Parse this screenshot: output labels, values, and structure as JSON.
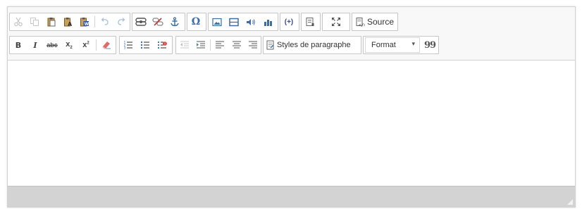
{
  "toolbar": {
    "source_label": "Source",
    "styles_label": "Styles de paragraphe",
    "format_label": "Format",
    "format_arrow": "▾",
    "bold_label": "B",
    "italic_label": "I",
    "strike_label": "abc",
    "subscript_label": "x",
    "subscript_mark": "2",
    "superscript_label": "x",
    "superscript_mark": "2",
    "placeholder_label": "(+)",
    "blockquote_label": "99",
    "special_char_label": "Ω"
  },
  "colors": {
    "toolbar_bg": "#f8f8f8",
    "icon_blue": "#3a6ea5",
    "icon_dark": "#555555",
    "status_bg": "#d3d3d3"
  }
}
